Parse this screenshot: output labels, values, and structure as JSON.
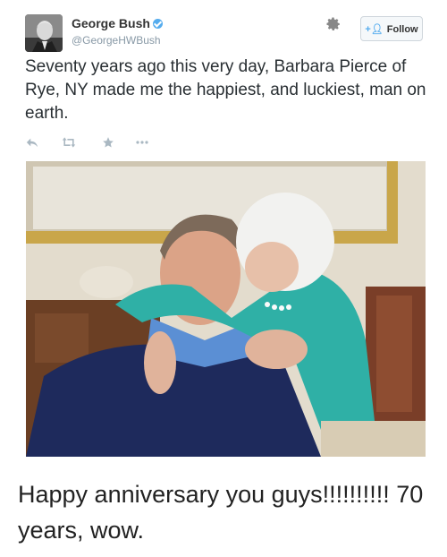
{
  "tweet": {
    "author_name": "George Bush",
    "handle": "@GeorgeHWBush",
    "follow_label": "Follow",
    "text": "Seventy years ago this very day, Barbara Pierce of Rye, NY made me the happiest, and luckiest, man on earth.",
    "icons": {
      "avatar": "avatar-photo",
      "verified": "verified-badge-icon",
      "gear": "gear-icon",
      "follow": "add-user-icon",
      "reply": "reply-icon",
      "retweet": "retweet-icon",
      "favorite": "star-icon",
      "more": "more-icon"
    },
    "colors": {
      "accent": "#55acee",
      "text": "#292f33",
      "muted": "#8899a6"
    }
  },
  "caption": "Happy anniversary you guys!!!!!!!!!! 70 years, wow."
}
